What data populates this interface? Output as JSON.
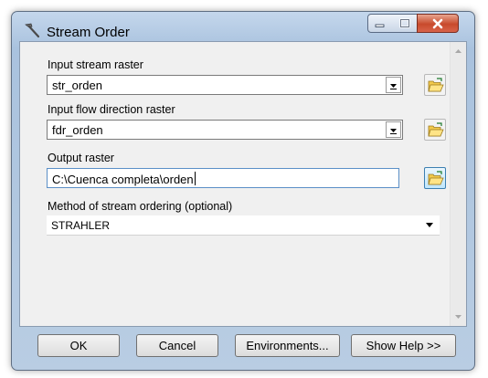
{
  "window": {
    "title": "Stream Order"
  },
  "fields": {
    "input_stream": {
      "label": "Input stream raster",
      "value": "str_orden"
    },
    "flow_direction": {
      "label": "Input flow direction raster",
      "value": "fdr_orden"
    },
    "output_raster": {
      "label": "Output raster",
      "value": "C:\\Cuenca completa\\orden"
    },
    "method": {
      "label": "Method of stream ordering (optional)",
      "value": "STRAHLER"
    }
  },
  "buttons": {
    "ok": "OK",
    "cancel": "Cancel",
    "environments": "Environments...",
    "show_help": "Show Help >>"
  },
  "icons": {
    "app": "tool-hammer-icon",
    "browse": "open-folder-icon",
    "dropdown": "chevron-down-icon"
  },
  "colors": {
    "title_bar": "#b9cde3",
    "close_button": "#c84a2c",
    "folder_yellow": "#f2c94c"
  }
}
